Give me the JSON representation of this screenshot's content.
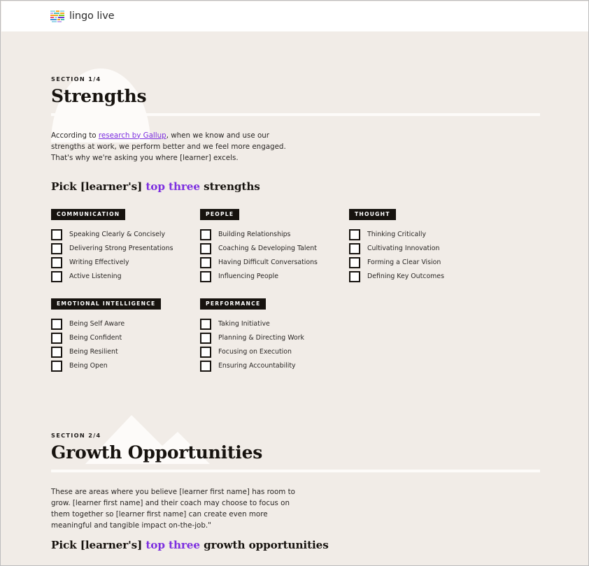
{
  "brand": {
    "name": "lingo live",
    "logo_icon": "lingo-live-bars-logo",
    "logo_colors": [
      "#f5a623",
      "#4ec0b4",
      "#e94b7c",
      "#6d3bd4",
      "#7ed321",
      "#4a90d9"
    ]
  },
  "theme": {
    "background": "#f1ece7",
    "header_background": "#ffffff",
    "ink": "#17130f",
    "accent_purple": "#7d2fe0",
    "badge_background": "#17130f",
    "badge_text": "#ffffff",
    "decoration_white": "#fdfbf9"
  },
  "sections": [
    {
      "label": "SECTION 1/4",
      "title": "Strengths",
      "decoration": "arch-shape",
      "body": {
        "before_link": "According to ",
        "link_text": "research by Gallup",
        "after_link": ", when we know and use our strengths at work, we perform better and we feel more engaged. That's why we're asking you where [learner] excels."
      },
      "pick": {
        "prefix": "Pick [learner's] ",
        "accent": "top three",
        "suffix": " strengths"
      },
      "categories": [
        {
          "name": "COMMUNICATION",
          "options": [
            "Speaking Clearly & Concisely",
            "Delivering Strong Presentations",
            "Writing Effectively",
            "Active Listening"
          ]
        },
        {
          "name": "PEOPLE",
          "options": [
            "Building Relationships",
            "Coaching & Developing Talent",
            "Having Difficult Conversations",
            "Influencing People"
          ]
        },
        {
          "name": "THOUGHT",
          "options": [
            "Thinking Critically",
            "Cultivating Innovation",
            "Forming a Clear Vision",
            "Defining Key Outcomes"
          ]
        },
        {
          "name": "EMOTIONAL INTELLIGENCE",
          "options": [
            "Being Self Aware",
            "Being Confident",
            "Being Resilient",
            "Being Open"
          ]
        },
        {
          "name": "PERFORMANCE",
          "options": [
            "Taking Initiative",
            "Planning & Directing Work",
            "Focusing on Execution",
            "Ensuring Accountability"
          ]
        }
      ]
    },
    {
      "label": "SECTION 2/4",
      "title": "Growth Opportunities",
      "decoration": "mountain-shape",
      "body": {
        "text": "These are areas where you believe [learner first name] has room to grow. [learner first name] and their coach may choose to focus on them together so [learner first name] can create even more meaningful and tangible impact on-the-job.\""
      },
      "pick": {
        "prefix": "Pick [learner's] ",
        "accent": "top three",
        "suffix": " growth opportunities"
      }
    }
  ]
}
